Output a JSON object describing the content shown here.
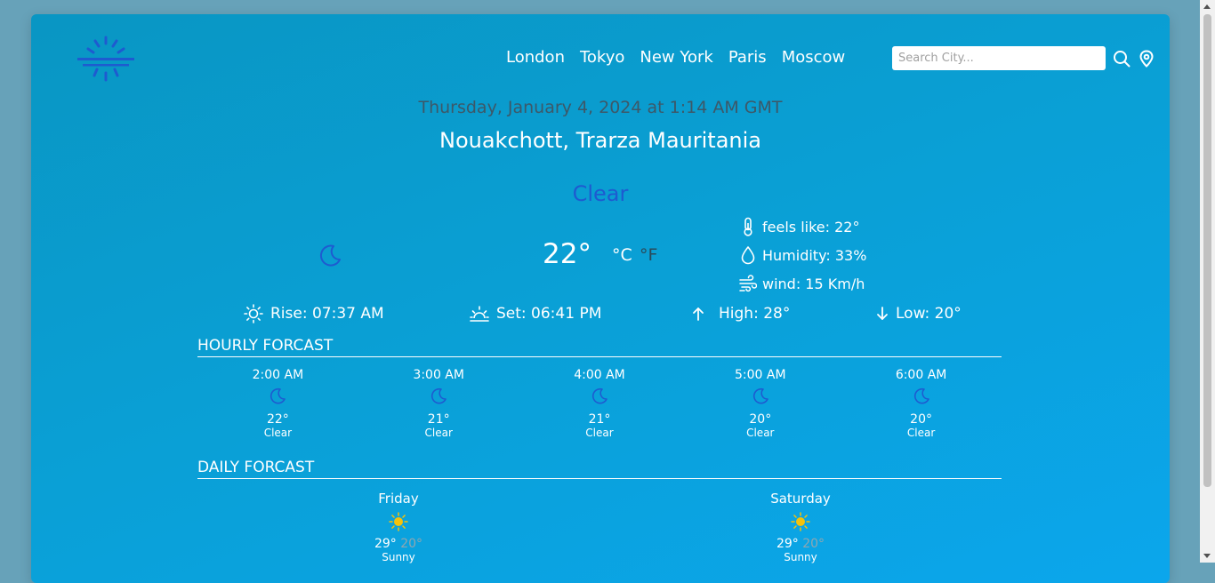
{
  "nav": [
    "London",
    "Tokyo",
    "New York",
    "Paris",
    "Moscow"
  ],
  "search": {
    "placeholder": "Search City..."
  },
  "date_text": "Thursday, January 4, 2024 at 1:14 AM GMT",
  "location": "Nouakchott, Trarza Mauritania",
  "condition": "Clear",
  "current": {
    "temp": "22°",
    "unit_c": "°C",
    "unit_f": "°F",
    "feels_like": "feels like: 22°",
    "humidity": "Humidity: 33%",
    "wind": "wind: 15 Km/h"
  },
  "sun": {
    "rise": "Rise: 07:37 AM",
    "set": "Set: 06:41 PM",
    "high": "High: 28°",
    "low": "Low: 20°"
  },
  "hourly_title": "HOURLY FORCAST",
  "hourly": [
    {
      "time": "2:00 AM",
      "temp": "22°",
      "cond": "Clear"
    },
    {
      "time": "3:00 AM",
      "temp": "21°",
      "cond": "Clear"
    },
    {
      "time": "4:00 AM",
      "temp": "21°",
      "cond": "Clear"
    },
    {
      "time": "5:00 AM",
      "temp": "20°",
      "cond": "Clear"
    },
    {
      "time": "6:00 AM",
      "temp": "20°",
      "cond": "Clear"
    }
  ],
  "daily_title": "DAILY FORCAST",
  "daily": [
    {
      "day": "Friday",
      "high": "29°",
      "low": "20°",
      "cond": "Sunny"
    },
    {
      "day": "Saturday",
      "high": "29°",
      "low": "20°",
      "cond": "Sunny"
    }
  ],
  "icons": {
    "main": "moon-icon",
    "hourly": "moon-icon",
    "daily": "sun-icon"
  },
  "colors": {
    "accent_blue": "#1e5bd0",
    "sun_yellow": "#f5c20a",
    "date_text": "#3d5868"
  }
}
